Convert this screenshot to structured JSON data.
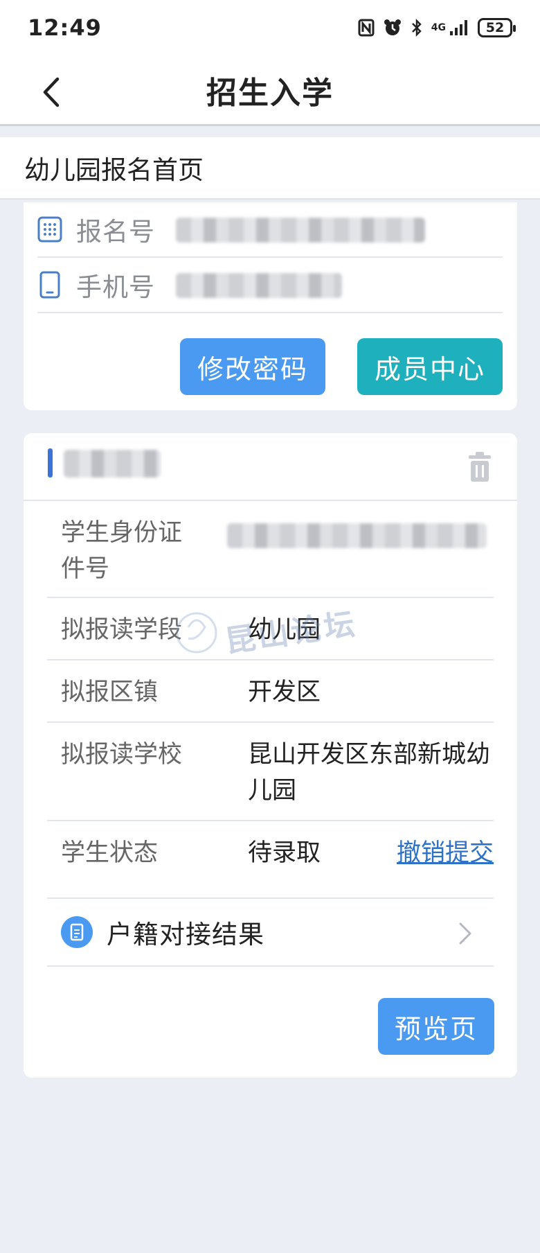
{
  "status_bar": {
    "time": "12:49",
    "signal_label": "4G",
    "battery": "52"
  },
  "nav": {
    "title": "招生入学"
  },
  "section": {
    "title": "幼儿园报名首页"
  },
  "account": {
    "reg_label": "报名号",
    "phone_label": "手机号",
    "change_password": "修改密码",
    "member_center": "成员中心"
  },
  "student": {
    "rows": [
      {
        "label": "学生身份证件号",
        "value": ""
      },
      {
        "label": "拟报读学段",
        "value": "幼儿园"
      },
      {
        "label": "拟报区镇",
        "value": "开发区"
      },
      {
        "label": "拟报读学校",
        "value": "昆山开发区东部新城幼儿园"
      },
      {
        "label": "学生状态",
        "value": "待录取"
      }
    ],
    "revoke": "撤销提交",
    "household": "户籍对接结果",
    "preview": "预览页"
  },
  "watermark": "昆山论坛",
  "colors": {
    "primary_blue": "#4a9af2",
    "teal": "#1fb0bd",
    "link_blue": "#2e72c8",
    "accent_bar": "#3b74d6",
    "background": "#ebeef5"
  }
}
